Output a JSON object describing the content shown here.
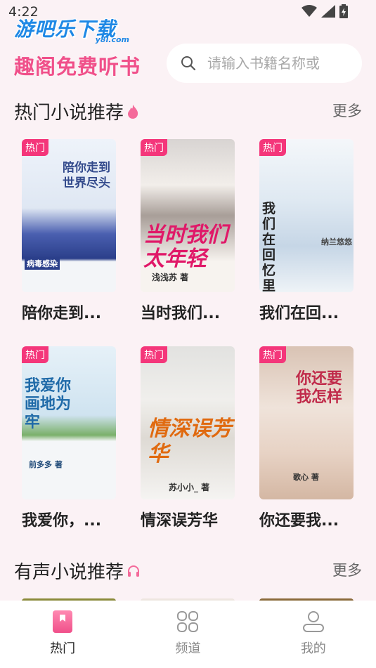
{
  "status_bar": {
    "time": "4:22"
  },
  "watermark": {
    "title": "游吧乐下载",
    "sub": "y8l.com"
  },
  "header": {
    "app_title": "趣阁免费听书",
    "search_placeholder": "请输入书籍名称或"
  },
  "hot_section": {
    "title": "热门小说推荐",
    "more": "更多",
    "badge": "热门",
    "books": [
      {
        "title": "陪你走到...",
        "cover_text": "陪你走到世界尽头",
        "cover_sub": "病毒感染",
        "colors": [
          "#e8eef8",
          "#3a4f9a"
        ]
      },
      {
        "title": "当时我们...",
        "cover_text": "当时我们太年轻",
        "cover_sub": "浅浅苏 著",
        "colors": [
          "#f4eee8",
          "#e01868"
        ]
      },
      {
        "title": "我们在回...",
        "cover_text": "我们在回忆里相忘",
        "cover_sub": "纳兰悠悠",
        "colors": [
          "#e6eef4",
          "#2a2a2a"
        ]
      },
      {
        "title": "我爱你，...",
        "cover_text": "我爱你画地为牢",
        "cover_sub": "前多多 著",
        "colors": [
          "#dcecf4",
          "#1f6aa8"
        ]
      },
      {
        "title": "情深误芳华",
        "cover_text": "情深误芳华",
        "cover_sub": "苏小小_ 著",
        "colors": [
          "#ececec",
          "#e06a10"
        ]
      },
      {
        "title": "你还要我...",
        "cover_text": "你还要我怎样",
        "cover_sub": "歌心 著",
        "colors": [
          "#efe2da",
          "#c02a4a"
        ]
      }
    ]
  },
  "audio_section": {
    "title": "有声小说推荐",
    "more": "更多"
  },
  "nav": [
    {
      "label": "热门",
      "icon": "bookmark-icon",
      "active": true
    },
    {
      "label": "频道",
      "icon": "grid-icon",
      "active": false
    },
    {
      "label": "我的",
      "icon": "person-icon",
      "active": false
    }
  ],
  "colors": {
    "accent": "#f0508a",
    "badge": "#f4367a",
    "background": "#fbf2f5"
  }
}
